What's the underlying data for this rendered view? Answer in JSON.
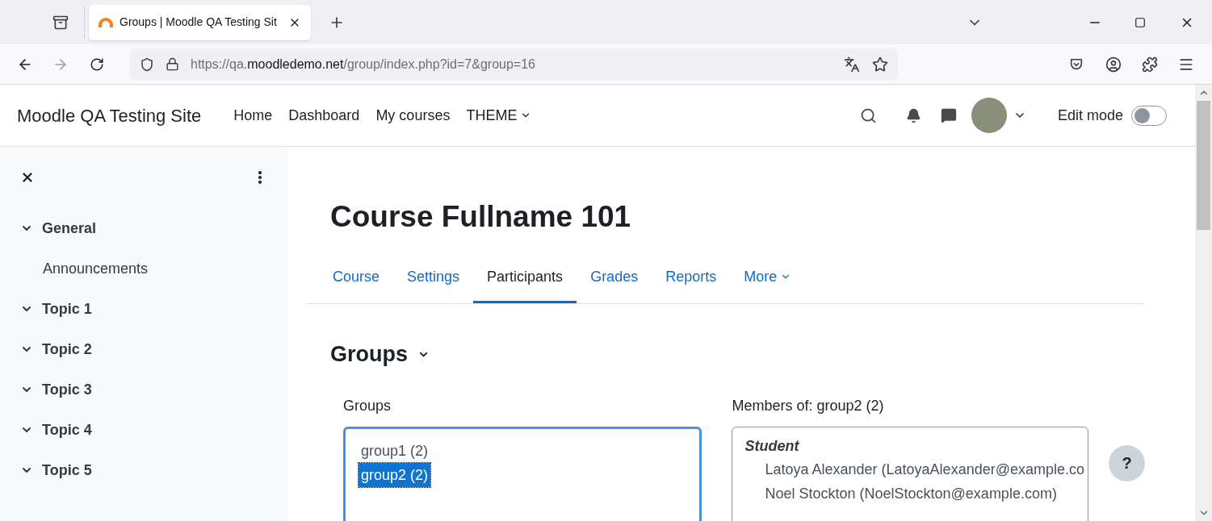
{
  "browser": {
    "tab_title": "Groups | Moodle QA Testing Sit",
    "url": {
      "scheme": "https://qa.",
      "domain": "moodledemo.net",
      "path": "/group/index.php?id=7&group=16"
    }
  },
  "navbar": {
    "site_name": "Moodle QA Testing Site",
    "links": [
      {
        "label": "Home",
        "dropdown": false
      },
      {
        "label": "Dashboard",
        "dropdown": false
      },
      {
        "label": "My courses",
        "dropdown": false
      },
      {
        "label": "THEME",
        "dropdown": true
      }
    ],
    "edit_mode": {
      "label": "Edit mode",
      "on": false
    }
  },
  "drawer": {
    "sections": [
      {
        "label": "General",
        "expanded": true,
        "children": [
          {
            "label": "Announcements"
          }
        ]
      },
      {
        "label": "Topic 1",
        "expanded": true
      },
      {
        "label": "Topic 2",
        "expanded": true
      },
      {
        "label": "Topic 3",
        "expanded": true
      },
      {
        "label": "Topic 4",
        "expanded": true
      },
      {
        "label": "Topic 5",
        "expanded": true
      }
    ]
  },
  "course": {
    "title": "Course Fullname 101",
    "tabs": [
      {
        "label": "Course",
        "selected": false,
        "dropdown": false
      },
      {
        "label": "Settings",
        "selected": false,
        "dropdown": false
      },
      {
        "label": "Participants",
        "selected": true,
        "dropdown": false
      },
      {
        "label": "Grades",
        "selected": false,
        "dropdown": false
      },
      {
        "label": "Reports",
        "selected": false,
        "dropdown": false
      },
      {
        "label": "More",
        "selected": false,
        "dropdown": true
      }
    ]
  },
  "page_heading": "Groups",
  "groups": {
    "label": "Groups",
    "items": [
      {
        "label": "group1 (2)",
        "selected": false
      },
      {
        "label": "group2 (2)",
        "selected": true
      }
    ]
  },
  "members": {
    "label": "Members of: group2 (2)",
    "roles": [
      {
        "role": "Student",
        "people": [
          "Latoya Alexander (LatoyaAlexander@example.co",
          "Noel Stockton (NoelStockton@example.com)"
        ]
      }
    ]
  },
  "help": {
    "label": "?"
  }
}
